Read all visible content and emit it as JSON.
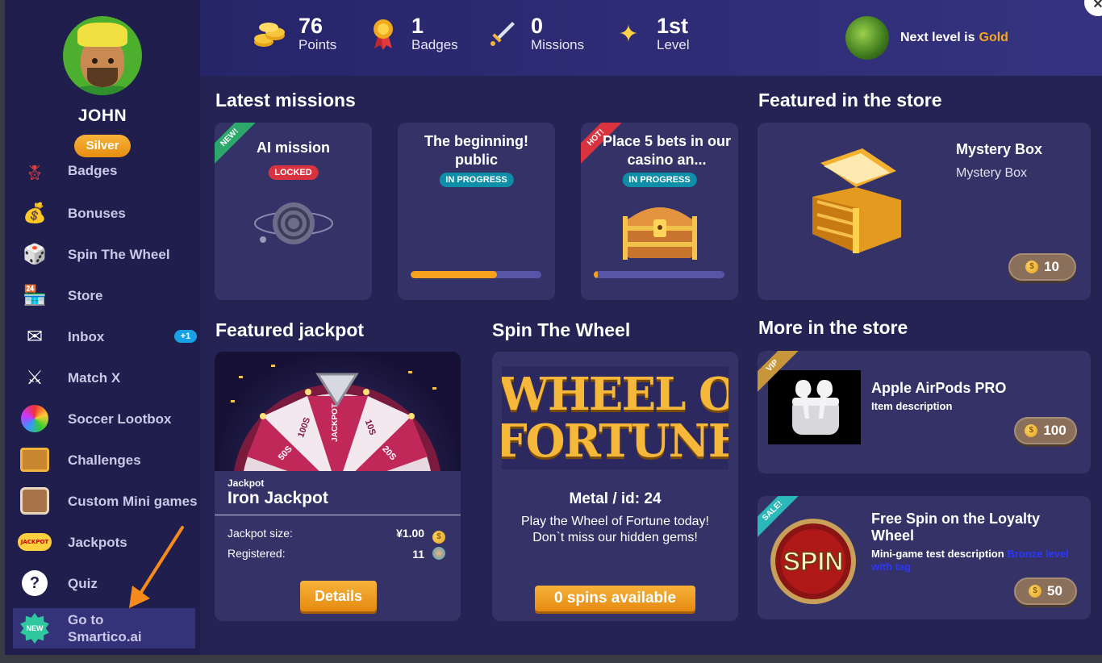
{
  "profile": {
    "name": "JOHN",
    "tier": "Silver"
  },
  "nav": {
    "items": [
      {
        "label": "Badges",
        "icon": "medal-icon"
      },
      {
        "label": "Bonuses",
        "icon": "money-bag-icon"
      },
      {
        "label": "Spin The Wheel",
        "icon": "dice-icon"
      },
      {
        "label": "Store",
        "icon": "store-icon"
      },
      {
        "label": "Inbox",
        "icon": "envelope-icon",
        "badge": "+1"
      },
      {
        "label": "Match X",
        "icon": "crossed-swords-icon"
      },
      {
        "label": "Soccer Lootbox",
        "icon": "color-wheel-icon"
      },
      {
        "label": "Challenges",
        "icon": "chest-icon"
      },
      {
        "label": "Custom Mini games",
        "icon": "treasure-chest-icon"
      },
      {
        "label": "Jackpots",
        "icon": "jackpot-icon",
        "icon_text": "JACKPOT"
      },
      {
        "label": "Quiz",
        "icon": "question-icon"
      },
      {
        "label": "Go to Smartico.ai",
        "icon": "new-star-icon",
        "icon_text": "NEW"
      }
    ]
  },
  "header": {
    "stats": [
      {
        "value": "76",
        "label": "Points",
        "icon": "coins-icon"
      },
      {
        "value": "1",
        "label": "Badges",
        "icon": "medal-icon"
      },
      {
        "value": "0",
        "label": "Missions",
        "icon": "sword-icon"
      },
      {
        "value": "1st",
        "label": "Level",
        "icon": "sparkles-icon"
      }
    ],
    "next_level_prefix": "Next level is",
    "next_level_name": "Gold"
  },
  "missions": {
    "title": "Latest missions",
    "items": [
      {
        "title": "AI mission",
        "status": "LOCKED",
        "ribbon": "NEW!"
      },
      {
        "title": "The beginning! public",
        "status": "IN PROGRESS",
        "progress": 0.66
      },
      {
        "title": "Place 5 bets in our casino an...",
        "status": "IN PROGRESS",
        "ribbon": "HOT!",
        "progress": 0.03
      }
    ]
  },
  "store_featured": {
    "title": "Featured in the store",
    "name": "Mystery Box",
    "desc": "Mystery Box",
    "price": "10"
  },
  "jackpot": {
    "title": "Featured jackpot",
    "kicker": "Jackpot",
    "name": "Iron Jackpot",
    "size_label": "Jackpot size:",
    "size_value": "¥1.00",
    "registered_label": "Registered:",
    "registered_value": "11",
    "details_button": "Details",
    "wheel_labels": [
      "JACKPOT",
      "10S",
      "20S",
      "50S",
      "100S"
    ]
  },
  "wheel": {
    "title": "Spin The Wheel",
    "banner_line1": "WHEEL OF",
    "banner_line2": "FORTUNE",
    "name": "Metal / id: 24",
    "desc": "Play the Wheel of Fortune today! Don`t miss our hidden gems!",
    "spins_button": "0 spins available"
  },
  "store_more": {
    "title": "More in the store",
    "items": [
      {
        "ribbon": "VIP",
        "name": "Apple AirPods PRO",
        "desc": "Item description",
        "tag": "",
        "price": "100"
      },
      {
        "ribbon": "SALE!",
        "name": "Free Spin on the Loyalty Wheel",
        "desc": "Mini-game test description",
        "tag": "Bronze level with tag",
        "price": "50",
        "image_text": "SPIN"
      }
    ]
  },
  "colors": {
    "accent": "#f5a623",
    "background": "#242353",
    "card": "#343266",
    "locked": "#d8333f",
    "in_progress": "#0f8fa7"
  }
}
